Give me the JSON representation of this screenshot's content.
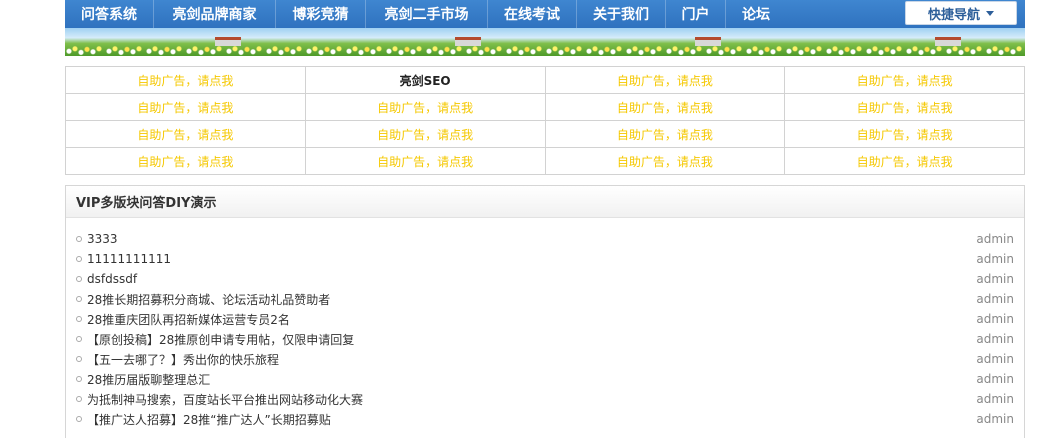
{
  "nav": {
    "items": [
      "问答系统",
      "亮剑品牌商家",
      "博彩竞猜",
      "亮剑二手市场",
      "在线考试",
      "关于我们",
      "门户",
      "论坛"
    ],
    "quick_nav_label": "快捷导航"
  },
  "ads": {
    "rows": [
      [
        "自助广告，请点我",
        "亮剑SEO",
        "自助广告，请点我",
        "自助广告，请点我"
      ],
      [
        "自助广告，请点我",
        "自助广告，请点我",
        "自助广告，请点我",
        "自助广告，请点我"
      ],
      [
        "自助广告，请点我",
        "自助广告，请点我",
        "自助广告，请点我",
        "自助广告，请点我"
      ],
      [
        "自助广告，请点我",
        "自助广告，请点我",
        "自助广告，请点我",
        "自助广告，请点我"
      ]
    ]
  },
  "panel": {
    "title": "VIP多版块问答DIY演示",
    "threads": [
      {
        "title": "3333",
        "author": "admin"
      },
      {
        "title": "11111111111",
        "author": "admin"
      },
      {
        "title": "dsfdssdf",
        "author": "admin"
      },
      {
        "title": "28推长期招募积分商城、论坛活动礼品赞助者",
        "author": "admin"
      },
      {
        "title": "28推重庆团队再招新媒体运营专员2名",
        "author": "admin"
      },
      {
        "title": "【原创投稿】28推原创申请专用帖，仅限申请回复",
        "author": "admin"
      },
      {
        "title": "【五一去哪了？】秀出你的快乐旅程",
        "author": "admin"
      },
      {
        "title": "28推历届版聊整理总汇",
        "author": "admin"
      },
      {
        "title": "为抵制神马搜索，百度站长平台推出网站移动化大赛",
        "author": "admin"
      },
      {
        "title": "【推广达人招募】28推“推广达人”长期招募贴",
        "author": "admin"
      }
    ]
  },
  "colors": {
    "nav_bg": "#2f72bf",
    "ad_text": "#f5c800"
  }
}
